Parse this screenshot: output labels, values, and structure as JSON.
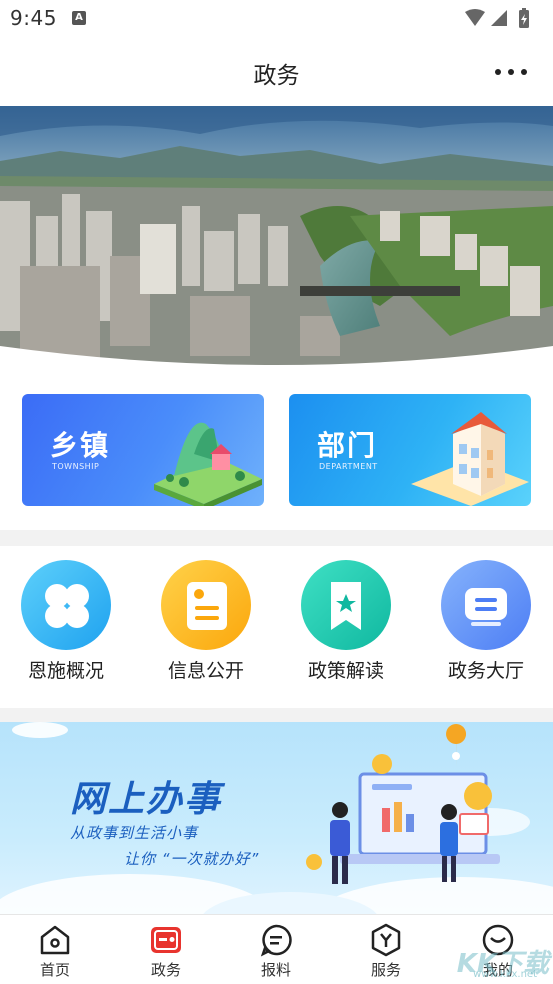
{
  "status_bar": {
    "time": "9:45",
    "notification_icon": "A"
  },
  "header": {
    "title": "政务",
    "more_icon": "more-icon"
  },
  "categories": [
    {
      "title": "乡镇",
      "subtitle": "TOWNSHIP"
    },
    {
      "title": "部门",
      "subtitle": "DEPARTMENT"
    }
  ],
  "quick_links": [
    {
      "label": "恩施概况",
      "icon": "clover-icon",
      "color": "#33b6f5"
    },
    {
      "label": "信息公开",
      "icon": "document-icon",
      "color": "#fdb515"
    },
    {
      "label": "政策解读",
      "icon": "bookmark-star-icon",
      "color": "#1fcfb8"
    },
    {
      "label": "政务大厅",
      "icon": "message-icon",
      "color": "#5b8df7"
    }
  ],
  "promo": {
    "title": "网上办事",
    "line1": "从政事到生活小事",
    "line2": "让你 “一次就办好”"
  },
  "bottom_nav": [
    {
      "label": "首页",
      "icon": "home-icon",
      "active": false
    },
    {
      "label": "政务",
      "icon": "government-icon",
      "active": true
    },
    {
      "label": "报料",
      "icon": "chat-icon",
      "active": false
    },
    {
      "label": "服务",
      "icon": "service-icon",
      "active": false
    },
    {
      "label": "我的",
      "icon": "profile-icon",
      "active": false
    }
  ],
  "watermark": {
    "text": "KK下载",
    "sub": "www.kkx.net"
  },
  "colors": {
    "accent": "#e8342e",
    "promo_text": "#1b5fbf"
  }
}
